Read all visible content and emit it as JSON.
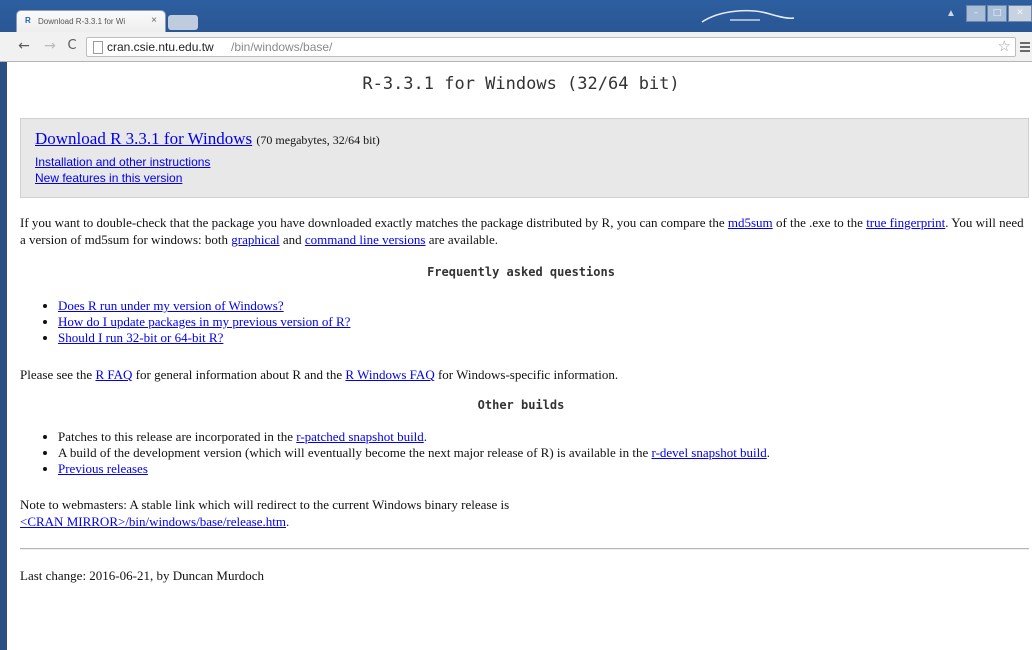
{
  "browser": {
    "tab_title": "Download R-3.3.1 for Wi",
    "tab_close": "×",
    "url_host": "cran.csie.ntu.edu.tw",
    "url_path": "/bin/windows/base/",
    "icons": {
      "back": "back-arrow-icon",
      "forward": "forward-arrow-icon",
      "reload": "reload-icon",
      "star": "bookmark-star-icon",
      "menu": "menu-icon"
    }
  },
  "page": {
    "title": "R-3.3.1 for Windows (32/64 bit)",
    "download": {
      "link": "Download R 3.3.1 for Windows",
      "size": "(70 megabytes, 32/64 bit)",
      "install_link": "Installation and other instructions",
      "features_link": "New features in this version"
    },
    "md5": {
      "t1": "If you want to double-check that the package you have downloaded exactly matches the package distributed by R, you can compare the ",
      "l1": "md5sum",
      "t2": " of the .exe to the ",
      "l2": "true fingerprint",
      "t3": ". You will need a version of md5sum for windows: both ",
      "l3": "graphical",
      "t4": " and ",
      "l4": "command line versions",
      "t5": " are available."
    },
    "faq": {
      "heading": "Frequently asked questions",
      "items": [
        "Does R run under my version of Windows?",
        "How do I update packages in my previous version of R?",
        "Should I run 32-bit or 64-bit R?"
      ]
    },
    "see_faq": {
      "t1": "Please see the ",
      "l1": "R FAQ",
      "t2": " for general information about R and the ",
      "l2": "R Windows FAQ",
      "t3": " for Windows-specific information."
    },
    "other": {
      "heading": "Other builds",
      "item1_text": "Patches to this release are incorporated in the ",
      "item1_link": "r-patched snapshot build",
      "item1_end": ".",
      "item2_text": "A build of the development version (which will eventually become the next major release of R) is available in the ",
      "item2_link": "r-devel snapshot build",
      "item2_end": ".",
      "item3_link": "Previous releases"
    },
    "note": {
      "text": "Note to webmasters: A stable link which will redirect to the current Windows binary release is",
      "link": "<CRAN MIRROR>/bin/windows/base/release.htm",
      "end": "."
    },
    "last_change": "Last change: 2016-06-21, by Duncan Murdoch"
  }
}
